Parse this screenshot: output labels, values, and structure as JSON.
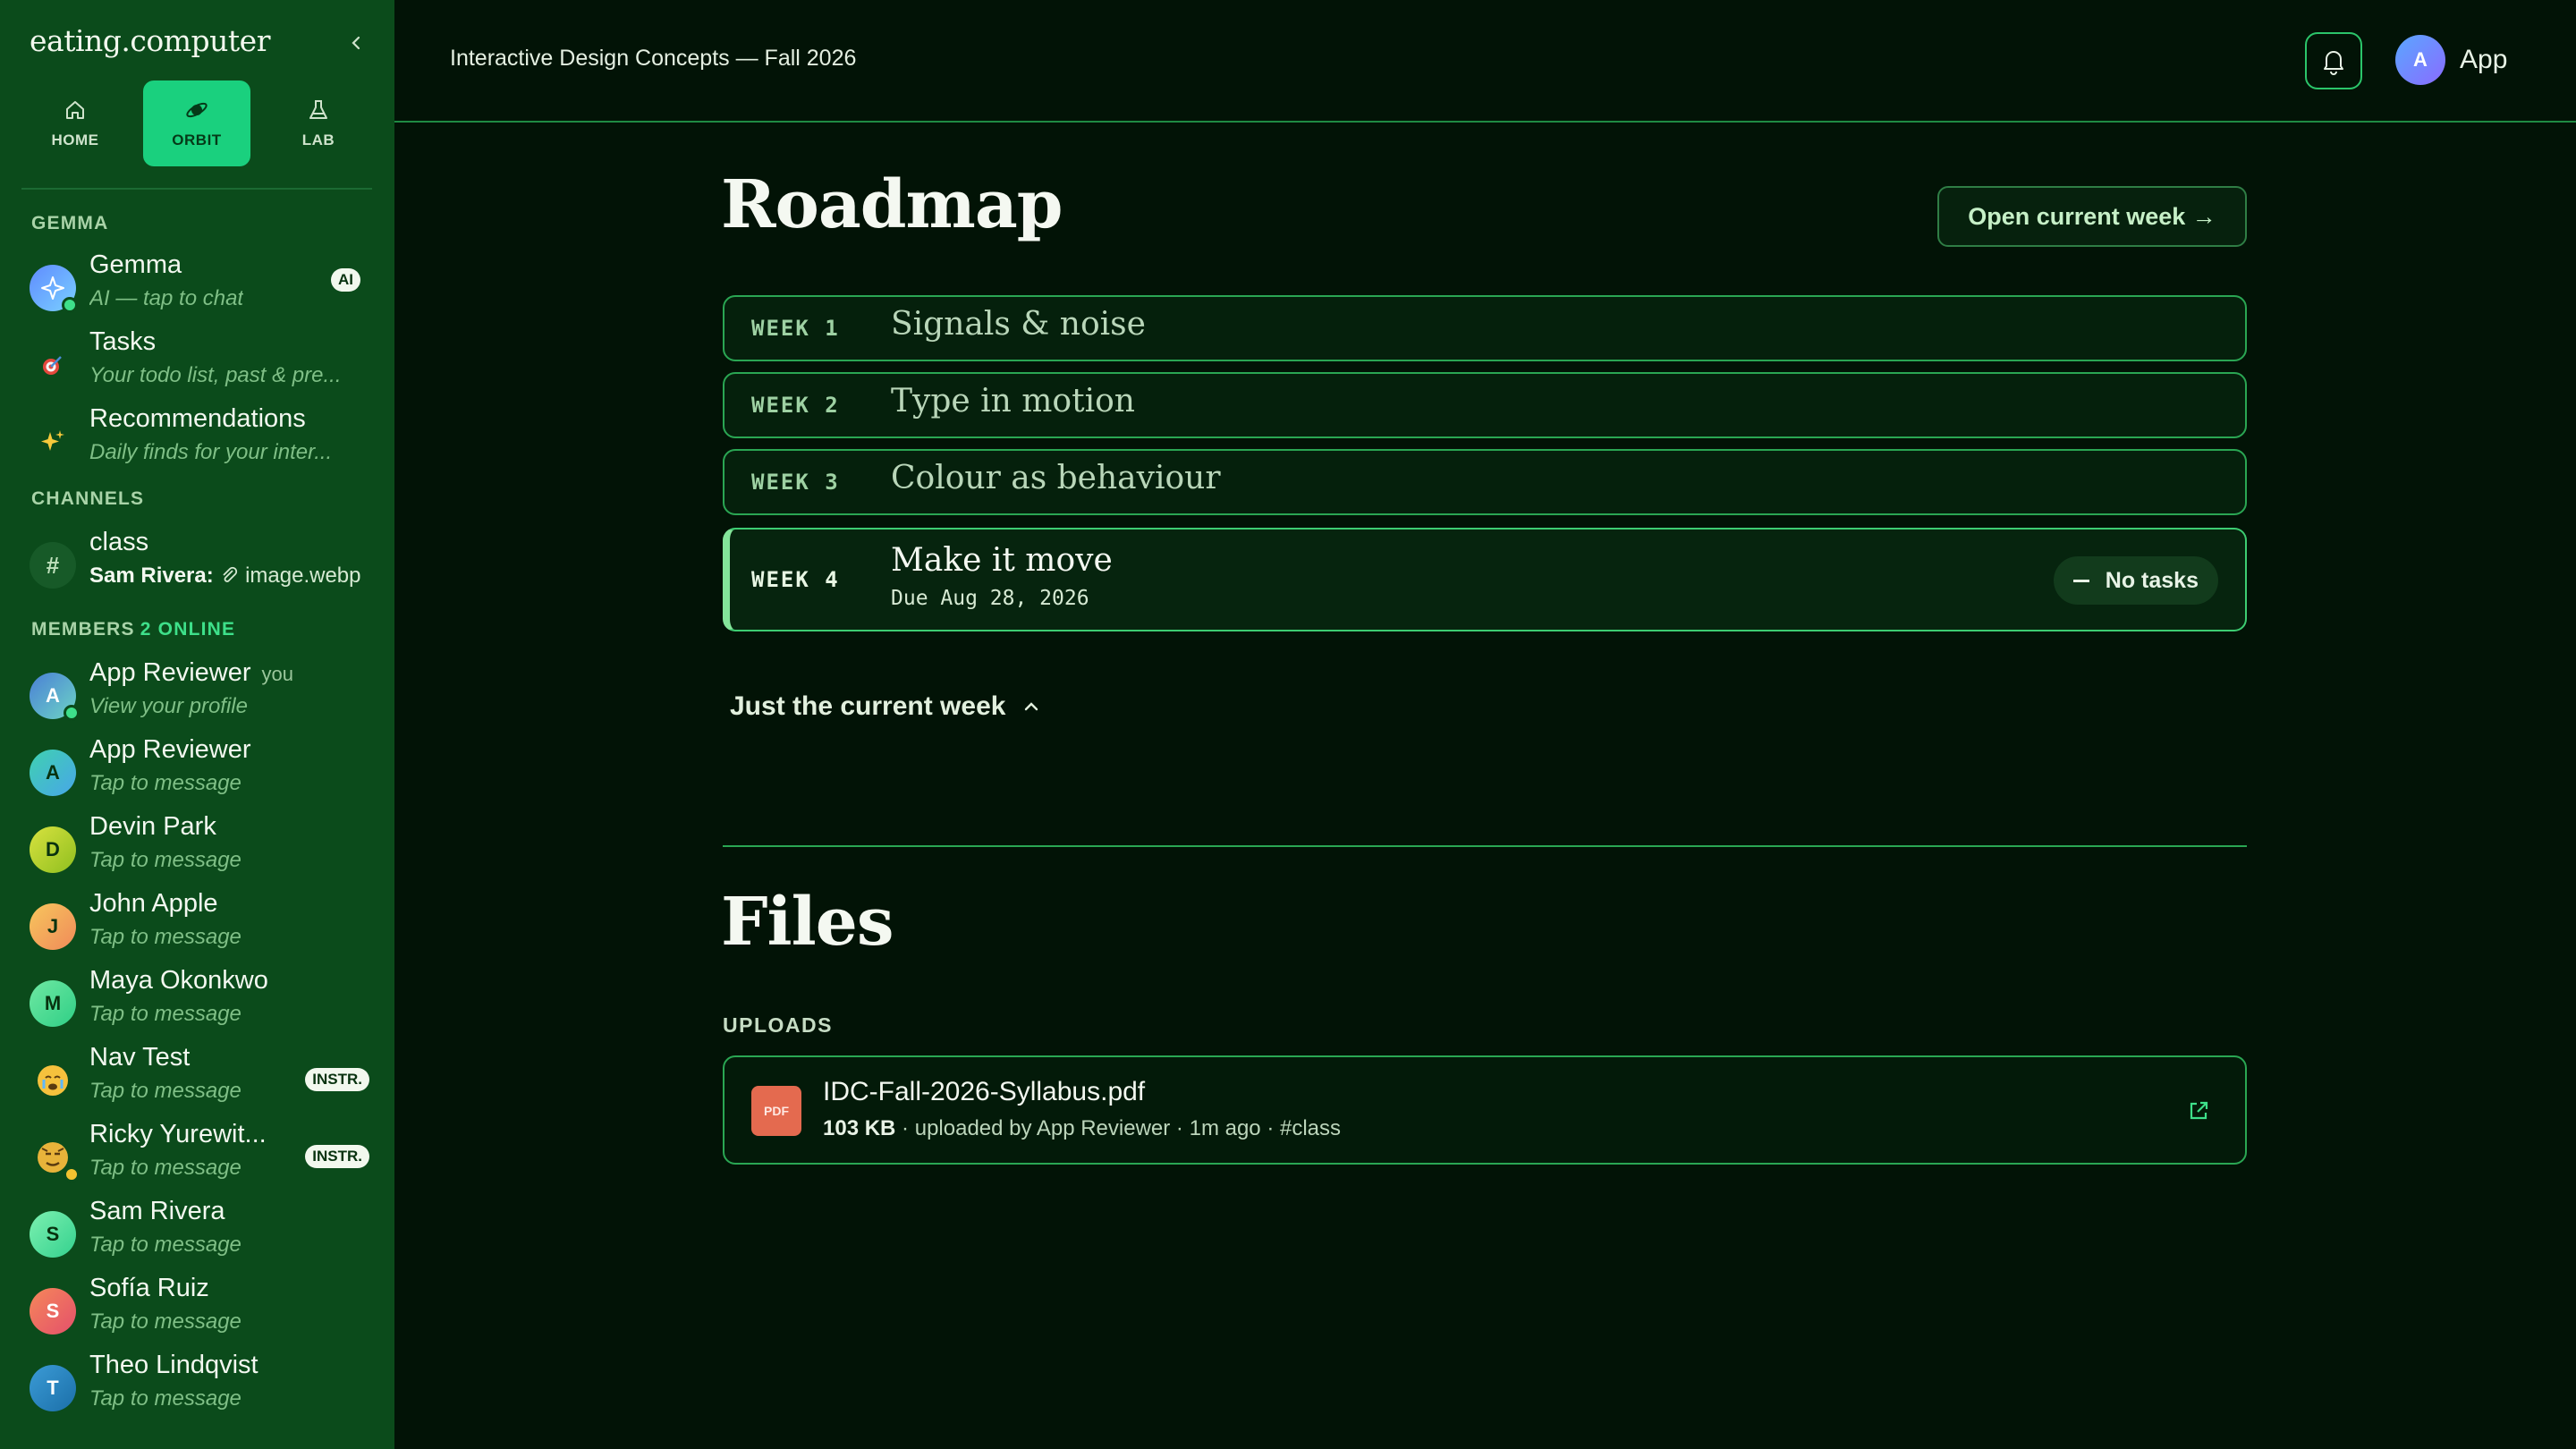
{
  "sidebar": {
    "brand": "eating.computer",
    "tabs": [
      {
        "label": "HOME",
        "icon": "home-icon"
      },
      {
        "label": "ORBIT",
        "icon": "orbit-icon"
      },
      {
        "label": "LAB",
        "icon": "flask-icon"
      }
    ],
    "sections": {
      "gemma": "GEMMA",
      "channels": "CHANNELS",
      "members": "MEMBERS",
      "online": "2 ONLINE"
    },
    "gemma_items": [
      {
        "name": "Gemma",
        "sub": "AI — tap to chat",
        "badge": "AI"
      },
      {
        "name": "Tasks",
        "sub": "Your todo list, past & pre..."
      },
      {
        "name": "Recommendations",
        "sub": "Daily finds for your inter..."
      }
    ],
    "channel": {
      "name": "class",
      "sender": "Sam Rivera:",
      "attachment": "image.webp",
      "icon": "#"
    },
    "members": [
      {
        "initial": "A",
        "name": "App Reviewer",
        "sub": "View your profile",
        "you": "you"
      },
      {
        "initial": "A",
        "name": "App Reviewer",
        "sub": "Tap to message"
      },
      {
        "initial": "D",
        "name": "Devin Park",
        "sub": "Tap to message"
      },
      {
        "initial": "J",
        "name": "John Apple",
        "sub": "Tap to message"
      },
      {
        "initial": "M",
        "name": "Maya Okonkwo",
        "sub": "Tap to message"
      },
      {
        "initial": "",
        "name": "Nav Test",
        "sub": "Tap to message",
        "badge": "INSTR."
      },
      {
        "initial": "",
        "name": "Ricky Yurewit...",
        "sub": "Tap to message",
        "badge": "INSTR."
      },
      {
        "initial": "S",
        "name": "Sam Rivera",
        "sub": "Tap to message"
      },
      {
        "initial": "S",
        "name": "Sofía Ruiz",
        "sub": "Tap to message"
      },
      {
        "initial": "T",
        "name": "Theo Lindqvist",
        "sub": "Tap to message"
      }
    ]
  },
  "topbar": {
    "course_title": "Interactive Design Concepts — Fall 2026",
    "user_initial": "A",
    "user_name": "App"
  },
  "roadmap": {
    "title": "Roadmap",
    "open_week_label": "Open current week →",
    "weeks": [
      {
        "label": "WEEK 1",
        "title": "Signals & noise"
      },
      {
        "label": "WEEK 2",
        "title": "Type in motion"
      },
      {
        "label": "WEEK 3",
        "title": "Colour as behaviour"
      },
      {
        "label": "WEEK 4",
        "title": "Make it move",
        "due": "Due Aug 28, 2026",
        "tasks": "No tasks"
      }
    ],
    "toggle_label": "Just the current week"
  },
  "files": {
    "title": "Files",
    "uploads_label": "UPLOADS",
    "items": [
      {
        "icon_label": "PDF",
        "name": "IDC-Fall-2026-Syllabus.pdf",
        "size": "103 KB",
        "uploader": "uploaded by App Reviewer",
        "when": "1m ago",
        "channel": "#class"
      }
    ]
  },
  "colors": {
    "sidebar_bg": "#0b4b1b",
    "page_bg": "#021306",
    "accent": "#1ad07e",
    "border": "#2aa653"
  }
}
